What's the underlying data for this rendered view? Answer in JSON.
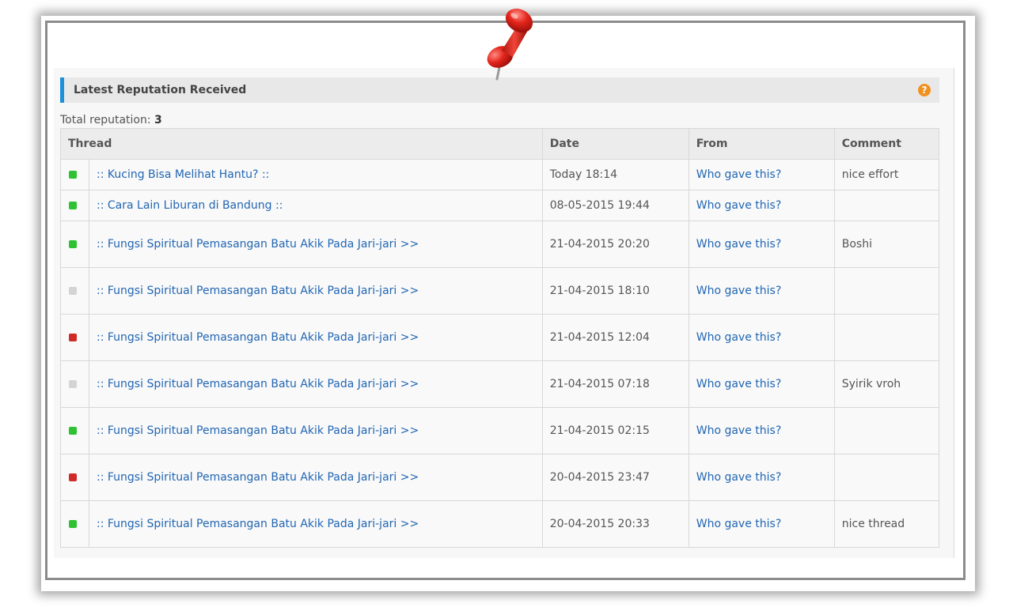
{
  "panel": {
    "title": "Latest Reputation Received",
    "help_icon": "help-circle-icon",
    "accent_color": "#1e8fd9"
  },
  "total": {
    "label": "Total reputation:",
    "value": "3"
  },
  "table": {
    "headers": {
      "thread": "Thread",
      "date": "Date",
      "from": "From",
      "comment": "Comment"
    },
    "rows": [
      {
        "status": "green",
        "thread": ":: Kucing Bisa Melihat Hantu? ::",
        "date": "Today 18:14",
        "from": "Who gave this?",
        "comment": "nice effort"
      },
      {
        "status": "green",
        "thread": ":: Cara Lain Liburan di Bandung ::",
        "date": "08-05-2015 19:44",
        "from": "Who gave this?",
        "comment": ""
      },
      {
        "status": "green",
        "thread": ":: Fungsi Spiritual Pemasangan Batu Akik Pada Jari-jari >>",
        "date": "21-04-2015 20:20",
        "from": "Who gave this?",
        "comment": "Boshi"
      },
      {
        "status": "grey",
        "thread": ":: Fungsi Spiritual Pemasangan Batu Akik Pada Jari-jari >>",
        "date": "21-04-2015 18:10",
        "from": "Who gave this?",
        "comment": ""
      },
      {
        "status": "red",
        "thread": ":: Fungsi Spiritual Pemasangan Batu Akik Pada Jari-jari >>",
        "date": "21-04-2015 12:04",
        "from": "Who gave this?",
        "comment": ""
      },
      {
        "status": "grey",
        "thread": ":: Fungsi Spiritual Pemasangan Batu Akik Pada Jari-jari >>",
        "date": "21-04-2015 07:18",
        "from": "Who gave this?",
        "comment": "Syirik vroh"
      },
      {
        "status": "green",
        "thread": ":: Fungsi Spiritual Pemasangan Batu Akik Pada Jari-jari >>",
        "date": "21-04-2015 02:15",
        "from": "Who gave this?",
        "comment": ""
      },
      {
        "status": "red",
        "thread": ":: Fungsi Spiritual Pemasangan Batu Akik Pada Jari-jari >>",
        "date": "20-04-2015 23:47",
        "from": "Who gave this?",
        "comment": ""
      },
      {
        "status": "green",
        "thread": ":: Fungsi Spiritual Pemasangan Batu Akik Pada Jari-jari >>",
        "date": "20-04-2015 20:33",
        "from": "Who gave this?",
        "comment": "nice thread"
      }
    ]
  },
  "status_colors": {
    "green": "#2ec131",
    "red": "#cf2a28",
    "grey": "#d4d4d4"
  },
  "decoration": {
    "pin_icon": "red-pushpin-icon"
  }
}
